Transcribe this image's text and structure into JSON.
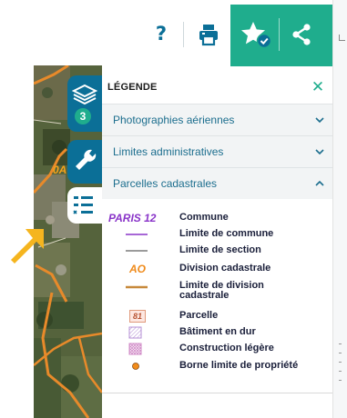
{
  "toolbar": {
    "help_label": "?",
    "help_icon": "question-icon",
    "print_icon": "printer-icon",
    "favorite_icon": "star-check-icon",
    "share_icon": "share-icon",
    "accent_color": "#1fad8d",
    "primary_color": "#0b6f97"
  },
  "sidebar": {
    "layers_icon": "layers-icon",
    "layers_count": "3",
    "tools_icon": "wrench-icon",
    "legend_icon": "legend-list-icon"
  },
  "map": {
    "parcel_label": "0A"
  },
  "legend": {
    "title": "LÉGENDE",
    "close_label": "✕",
    "sections": [
      {
        "label": "Photographies aériennes",
        "expanded": false
      },
      {
        "label": "Limites administratives",
        "expanded": false
      },
      {
        "label": "Parcelles cadastrales",
        "expanded": true
      }
    ],
    "items": [
      {
        "symbol_text": "PARIS 12",
        "label": "Commune"
      },
      {
        "label": "Limite de commune",
        "color": "#8a35c9"
      },
      {
        "label": "Limite de section",
        "color": "#9b9b9b"
      },
      {
        "symbol_text": "AO",
        "label": "Division cadastrale"
      },
      {
        "label": "Limite de division cadastrale",
        "color": "#c7893b"
      },
      {
        "symbol_text": "81",
        "label": "Parcelle"
      },
      {
        "label": "Bâtiment en dur"
      },
      {
        "label": "Construction légère"
      },
      {
        "label": "Borne limite de propriété",
        "color": "#f28c1a"
      }
    ]
  }
}
